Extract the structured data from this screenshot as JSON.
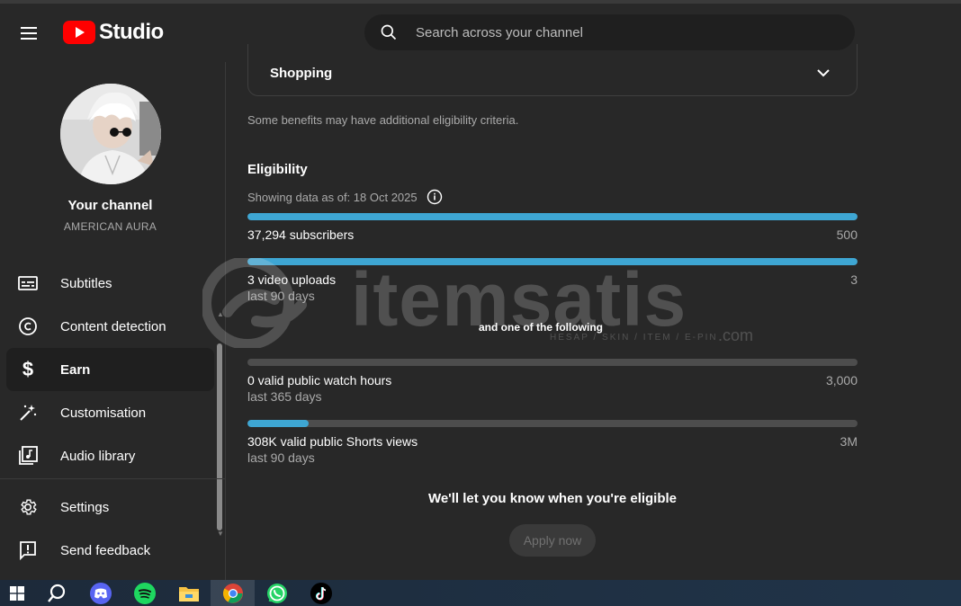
{
  "app": {
    "logo_text": "Studio"
  },
  "search": {
    "placeholder": "Search across your channel"
  },
  "sidebar": {
    "channel_title": "Your channel",
    "channel_name": "AMERICAN AURA",
    "items": [
      {
        "label": "Subtitles",
        "icon": "subtitles-icon"
      },
      {
        "label": "Content detection",
        "icon": "copyright-icon"
      },
      {
        "label": "Earn",
        "icon": "dollar-icon",
        "active": true
      },
      {
        "label": "Customisation",
        "icon": "magic-wand-icon"
      },
      {
        "label": "Audio library",
        "icon": "audio-library-icon"
      }
    ],
    "bottom_items": [
      {
        "label": "Settings",
        "icon": "gear-icon"
      },
      {
        "label": "Send feedback",
        "icon": "feedback-icon"
      }
    ]
  },
  "main": {
    "shopping_label": "Shopping",
    "benefits_note": "Some benefits may have additional eligibility criteria.",
    "eligibility_title": "Eligibility",
    "data_date": "Showing data as of: 18 Oct 2025",
    "requirements": [
      {
        "label": "37,294 subscribers",
        "sub": "",
        "target": "500",
        "progress": 1.0
      },
      {
        "label": "3 video uploads",
        "sub": "last 90 days",
        "target": "3",
        "progress": 1.0
      }
    ],
    "one_of_label": "and one of the following",
    "alternatives": [
      {
        "label": "0 valid public watch hours",
        "sub": "last 365 days",
        "target": "3,000",
        "progress": 0.0
      },
      {
        "label": "308K valid public Shorts views",
        "sub": "last 90 days",
        "target": "3M",
        "progress": 0.1
      }
    ],
    "notify_message": "We'll let you know when you're eligible",
    "apply_button": "Apply now"
  },
  "watermark": {
    "text": "itemsatis",
    "subtext": "HESAP / SKIN / ITEM / E-PIN",
    "suffix": ".com"
  },
  "taskbar": {
    "items": [
      "windows-start-icon",
      "search-icon",
      "discord-icon",
      "spotify-icon",
      "file-explorer-icon",
      "chrome-icon",
      "whatsapp-icon",
      "tiktok-icon"
    ],
    "active": "chrome-icon"
  },
  "colors": {
    "accent": "#3ea6d3",
    "brand_red": "#ff0000",
    "background": "#282828"
  }
}
